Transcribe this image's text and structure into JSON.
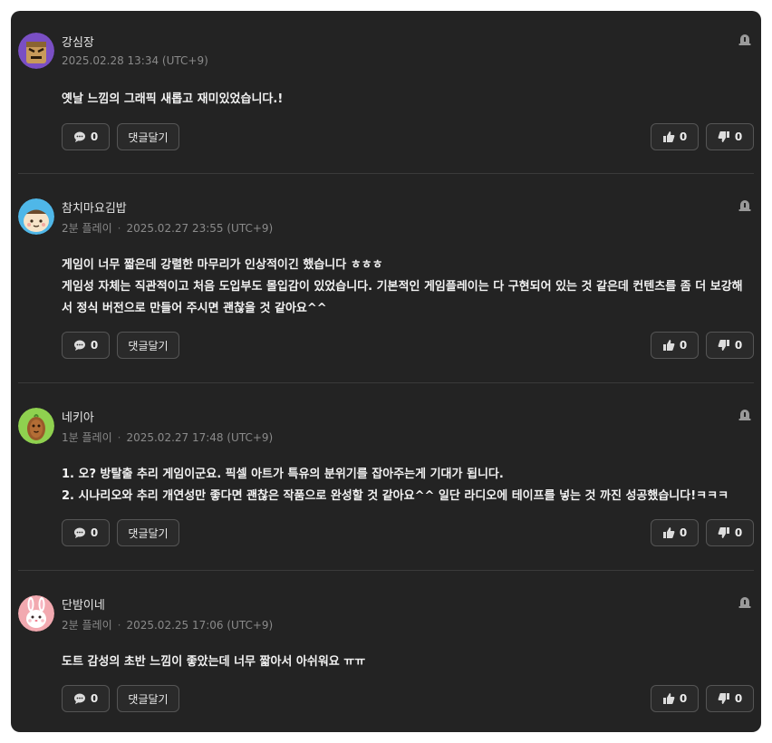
{
  "comments": [
    {
      "username": "강심장",
      "meta_prefix": "",
      "timestamp": "2025.02.28 13:34 (UTC+9)",
      "lines": [
        "옛날 느낌의 그래픽 새롭고 재미있었습니다.!"
      ],
      "comment_count": "0",
      "reply_label": "댓글달기",
      "likes": "0",
      "dislikes": "0",
      "avatar_icon": "angry-block-avatar-icon"
    },
    {
      "username": "참치마요김밥",
      "meta_prefix": "2분 플레이",
      "timestamp": "2025.02.27 23:55 (UTC+9)",
      "lines": [
        "게임이 너무 짧은데 강렬한 마무리가 인상적이긴 했습니다 ㅎㅎㅎ",
        "게임성 자체는 직관적이고 처음 도입부도 몰입감이 있었습니다. 기본적인 게임플레이는 다 구현되어 있는 것 같은데 컨텐츠를 좀 더 보강해",
        "서 정식 버전으로 만들어 주시면 괜찮을 것 같아요^^"
      ],
      "comment_count": "0",
      "reply_label": "댓글달기",
      "likes": "0",
      "dislikes": "0",
      "avatar_icon": "chef-character-avatar-icon"
    },
    {
      "username": "네키아",
      "meta_prefix": "1분 플레이",
      "timestamp": "2025.02.27 17:48 (UTC+9)",
      "lines": [
        "1. 오? 방탈출 추리 게임이군요. 픽셀 아트가 특유의 분위기를 잡아주는게 기대가 됩니다.",
        "2. 시나리오와 추리 개연성만 좋다면 괜찮은 작품으로 완성할 것 같아요^^ 일단 라디오에 테이프를 넣는 것 까진 성공했습니다!ㅋㅋㅋ"
      ],
      "comment_count": "0",
      "reply_label": "댓글달기",
      "likes": "0",
      "dislikes": "0",
      "avatar_icon": "potato-character-avatar-icon"
    },
    {
      "username": "단밤이네",
      "meta_prefix": "2분 플레이",
      "timestamp": "2025.02.25 17:06 (UTC+9)",
      "lines": [
        "도트 감성의 초반 느낌이 좋았는데 너무 짧아서 아쉬워요 ㅠㅠ"
      ],
      "comment_count": "0",
      "reply_label": "댓글달기",
      "likes": "0",
      "dislikes": "0",
      "avatar_icon": "bunny-avatar-icon"
    }
  ],
  "colors": {
    "panel_bg": "#232323",
    "text_primary": "#f2f2f2",
    "text_meta": "#8a8a8a",
    "button_border": "#555555"
  }
}
